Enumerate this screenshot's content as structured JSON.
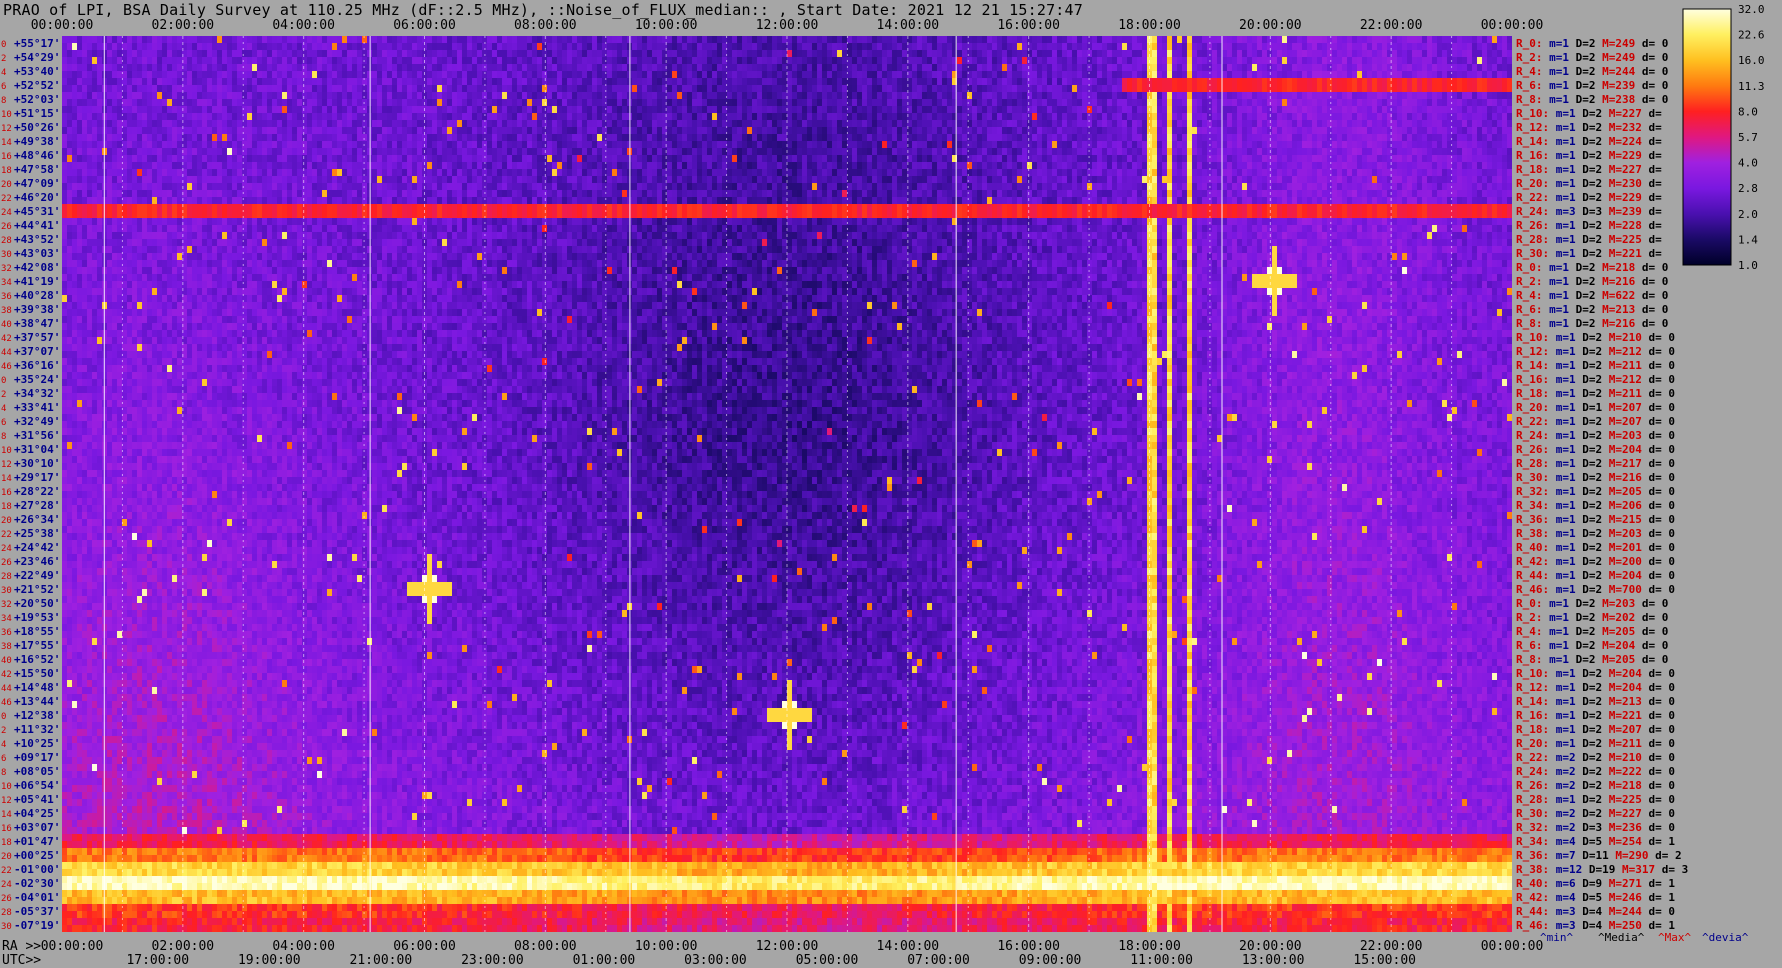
{
  "title": "PRAO of LPI, BSA Daily Survey at 110.25 MHz (dF::2.5 MHz), ::Noise_of_FLUX_median:: , Start Date: 2021 12 21 15:27:47",
  "chart_data": {
    "type": "heatmap",
    "top_time_ticks": [
      "00:00:00",
      "02:00:00",
      "04:00:00",
      "06:00:00",
      "08:00:00",
      "10:00:00",
      "12:00:00",
      "14:00:00",
      "16:00:00",
      "18:00:00",
      "20:00:00",
      "22:00:00",
      "00:00:00"
    ],
    "ra_axis_label": "RA >>",
    "ra_ticks": [
      "00:00:00",
      "02:00:00",
      "04:00:00",
      "06:00:00",
      "08:00:00",
      "10:00:00",
      "12:00:00",
      "14:00:00",
      "16:00:00",
      "18:00:00",
      "20:00:00",
      "22:00:00",
      "00:00:00"
    ],
    "utc_axis_label": "UTC>>",
    "utc_ticks": [
      "17:00:00",
      "19:00:00",
      "21:00:00",
      "23:00:00",
      "01:00:00",
      "03:00:00",
      "05:00:00",
      "07:00:00",
      "09:00:00",
      "11:00:00",
      "13:00:00",
      "15:00:00"
    ],
    "declinations": [
      "+55°17'",
      "+54°29'",
      "+53°40'",
      "+52°52'",
      "+52°03'",
      "+51°15'",
      "+50°26'",
      "+49°38'",
      "+48°46'",
      "+47°58'",
      "+47°09'",
      "+46°20'",
      "+45°31'",
      "+44°41'",
      "+43°52'",
      "+43°03'",
      "+42°08'",
      "+41°19'",
      "+40°28'",
      "+39°38'",
      "+38°47'",
      "+37°57'",
      "+37°07'",
      "+36°16'",
      "+35°24'",
      "+34°32'",
      "+33°41'",
      "+32°49'",
      "+31°56'",
      "+31°04'",
      "+30°10'",
      "+29°17'",
      "+28°22'",
      "+27°28'",
      "+26°34'",
      "+25°38'",
      "+24°42'",
      "+23°46'",
      "+22°49'",
      "+21°52'",
      "+20°50'",
      "+19°53'",
      "+18°55'",
      "+17°55'",
      "+16°52'",
      "+15°50'",
      "+14°48'",
      "+13°44'",
      "+12°38'",
      "+11°32'",
      "+10°25'",
      "+09°17'",
      "+08°05'",
      "+06°54'",
      "+05°41'",
      "+04°25'",
      "+03°07'",
      "+01°47'",
      "+00°25'",
      "-01°00'",
      "-02°30'",
      "-04°01'",
      "-05°37'",
      "-07°19'"
    ],
    "row_numbers": [
      "0",
      "2",
      "4",
      "6",
      "8",
      "10",
      "12",
      "14",
      "16",
      "18",
      "20",
      "22",
      "24",
      "26",
      "28",
      "30",
      "32",
      "34",
      "36",
      "38",
      "40",
      "42",
      "44",
      "46",
      "0",
      "2",
      "4",
      "6",
      "8",
      "10",
      "12",
      "14",
      "16",
      "18",
      "20",
      "22",
      "24",
      "26",
      "28",
      "30",
      "32",
      "34",
      "36",
      "38",
      "40",
      "42",
      "44",
      "46",
      "0",
      "2",
      "4",
      "6",
      "8",
      "10",
      "12",
      "14",
      "16",
      "18",
      "20",
      "22",
      "24",
      "26",
      "28",
      "30",
      "32",
      "34",
      "36",
      "38",
      "40",
      "42",
      "44",
      "46"
    ],
    "stats_rows": [
      [
        "R_0:",
        "m=1",
        "D=2",
        "M=249",
        "d= 0"
      ],
      [
        "R_2:",
        "m=1",
        "D=2",
        "M=249",
        "d= 0"
      ],
      [
        "R_4:",
        "m=1",
        "D=2",
        "M=244",
        "d= 0"
      ],
      [
        "R_6:",
        "m=1",
        "D=2",
        "M=239",
        "d= 0"
      ],
      [
        "R_8:",
        "m=1",
        "D=2",
        "M=238",
        "d= 0"
      ],
      [
        "R_10:",
        "m=1",
        "D=2",
        "M=227",
        "d="
      ],
      [
        "R_12:",
        "m=1",
        "D=2",
        "M=232",
        "d="
      ],
      [
        "R_14:",
        "m=1",
        "D=2",
        "M=224",
        "d="
      ],
      [
        "R_16:",
        "m=1",
        "D=2",
        "M=229",
        "d="
      ],
      [
        "R_18:",
        "m=1",
        "D=2",
        "M=227",
        "d="
      ],
      [
        "R_20:",
        "m=1",
        "D=2",
        "M=230",
        "d="
      ],
      [
        "R_22:",
        "m=1",
        "D=2",
        "M=229",
        "d="
      ],
      [
        "R_24:",
        "m=3",
        "D=3",
        "M=239",
        "d="
      ],
      [
        "R_26:",
        "m=1",
        "D=2",
        "M=228",
        "d="
      ],
      [
        "R_28:",
        "m=1",
        "D=2",
        "M=225",
        "d="
      ],
      [
        "R_30:",
        "m=1",
        "D=2",
        "M=221",
        "d="
      ],
      [
        "R_0:",
        "m=1",
        "D=2",
        "M=218",
        "d= 0"
      ],
      [
        "R_2:",
        "m=1",
        "D=2",
        "M=216",
        "d= 0"
      ],
      [
        "R_4:",
        "m=1",
        "D=2",
        "M=622",
        "d= 0"
      ],
      [
        "R_6:",
        "m=1",
        "D=2",
        "M=213",
        "d= 0"
      ],
      [
        "R_8:",
        "m=1",
        "D=2",
        "M=216",
        "d= 0"
      ],
      [
        "R_10:",
        "m=1",
        "D=2",
        "M=210",
        "d= 0"
      ],
      [
        "R_12:",
        "m=1",
        "D=2",
        "M=212",
        "d= 0"
      ],
      [
        "R_14:",
        "m=1",
        "D=2",
        "M=211",
        "d= 0"
      ],
      [
        "R_16:",
        "m=1",
        "D=2",
        "M=212",
        "d= 0"
      ],
      [
        "R_18:",
        "m=1",
        "D=2",
        "M=211",
        "d= 0"
      ],
      [
        "R_20:",
        "m=1",
        "D=1",
        "M=207",
        "d= 0"
      ],
      [
        "R_22:",
        "m=1",
        "D=2",
        "M=207",
        "d= 0"
      ],
      [
        "R_24:",
        "m=1",
        "D=2",
        "M=203",
        "d= 0"
      ],
      [
        "R_26:",
        "m=1",
        "D=2",
        "M=204",
        "d= 0"
      ],
      [
        "R_28:",
        "m=1",
        "D=2",
        "M=217",
        "d= 0"
      ],
      [
        "R_30:",
        "m=1",
        "D=2",
        "M=216",
        "d= 0"
      ],
      [
        "R_32:",
        "m=1",
        "D=2",
        "M=205",
        "d= 0"
      ],
      [
        "R_34:",
        "m=1",
        "D=2",
        "M=206",
        "d= 0"
      ],
      [
        "R_36:",
        "m=1",
        "D=2",
        "M=215",
        "d= 0"
      ],
      [
        "R_38:",
        "m=1",
        "D=2",
        "M=203",
        "d= 0"
      ],
      [
        "R_40:",
        "m=1",
        "D=2",
        "M=201",
        "d= 0"
      ],
      [
        "R_42:",
        "m=1",
        "D=2",
        "M=200",
        "d= 0"
      ],
      [
        "R_44:",
        "m=1",
        "D=2",
        "M=204",
        "d= 0"
      ],
      [
        "R_46:",
        "m=1",
        "D=2",
        "M=700",
        "d= 0"
      ],
      [
        "R_0:",
        "m=1",
        "D=2",
        "M=203",
        "d= 0"
      ],
      [
        "R_2:",
        "m=1",
        "D=2",
        "M=202",
        "d= 0"
      ],
      [
        "R_4:",
        "m=1",
        "D=2",
        "M=205",
        "d= 0"
      ],
      [
        "R_6:",
        "m=1",
        "D=2",
        "M=204",
        "d= 0"
      ],
      [
        "R_8:",
        "m=1",
        "D=2",
        "M=205",
        "d= 0"
      ],
      [
        "R_10:",
        "m=1",
        "D=2",
        "M=204",
        "d= 0"
      ],
      [
        "R_12:",
        "m=1",
        "D=2",
        "M=204",
        "d= 0"
      ],
      [
        "R_14:",
        "m=1",
        "D=2",
        "M=213",
        "d= 0"
      ],
      [
        "R_16:",
        "m=1",
        "D=2",
        "M=221",
        "d= 0"
      ],
      [
        "R_18:",
        "m=1",
        "D=2",
        "M=207",
        "d= 0"
      ],
      [
        "R_20:",
        "m=1",
        "D=2",
        "M=211",
        "d= 0"
      ],
      [
        "R_22:",
        "m=2",
        "D=2",
        "M=210",
        "d= 0"
      ],
      [
        "R_24:",
        "m=2",
        "D=2",
        "M=222",
        "d= 0"
      ],
      [
        "R_26:",
        "m=2",
        "D=2",
        "M=218",
        "d= 0"
      ],
      [
        "R_28:",
        "m=1",
        "D=2",
        "M=225",
        "d= 0"
      ],
      [
        "R_30:",
        "m=2",
        "D=2",
        "M=227",
        "d= 0"
      ],
      [
        "R_32:",
        "m=2",
        "D=3",
        "M=236",
        "d= 0"
      ],
      [
        "R_34:",
        "m=4",
        "D=5",
        "M=254",
        "d= 1"
      ],
      [
        "R_36:",
        "m=7",
        "D=11",
        "M=290",
        "d= 2"
      ],
      [
        "R_38:",
        "m=12",
        "D=19",
        "M=317",
        "d= 3"
      ],
      [
        "R_40:",
        "m=6",
        "D=9",
        "M=271",
        "d= 1"
      ],
      [
        "R_42:",
        "m=4",
        "D=5",
        "M=246",
        "d= 1"
      ],
      [
        "R_44:",
        "m=3",
        "D=4",
        "M=244",
        "d= 0"
      ],
      [
        "R_46:",
        "m=3",
        "D=4",
        "M=250",
        "d= 1"
      ]
    ],
    "stats_footer": [
      "^min^",
      "^Media^",
      "^Max^",
      "^devia^"
    ],
    "colorbar_ticks": [
      32.0,
      22.6,
      16.0,
      11.3,
      8.0,
      5.7,
      4.0,
      2.8,
      2.0,
      1.4,
      1.0
    ],
    "colorscale": [
      "#000028",
      "#1a0a66",
      "#4a10b0",
      "#7a18e0",
      "#a020e0",
      "#e01880",
      "#ff2020",
      "#ff7a10",
      "#ffc020",
      "#fff060",
      "#ffffe0"
    ],
    "bright_columns_ra_hours": [
      18.0,
      18.3,
      18.6
    ],
    "bright_rows_decl": [
      "+45°31'",
      "+52°52'"
    ],
    "bright_sources": [
      {
        "ra_hours": 20.0,
        "decl": "+41°19'"
      },
      {
        "ra_hours": 6.0,
        "decl": "+21°52'"
      },
      {
        "ra_hours": 12.0,
        "decl": "+12°38'"
      }
    ],
    "galactic_plane_rows": [
      "+01°47'",
      "+00°25'",
      "-01°00'",
      "-02°30'",
      "-04°01'",
      "-05°37'",
      "-07°19'"
    ]
  }
}
